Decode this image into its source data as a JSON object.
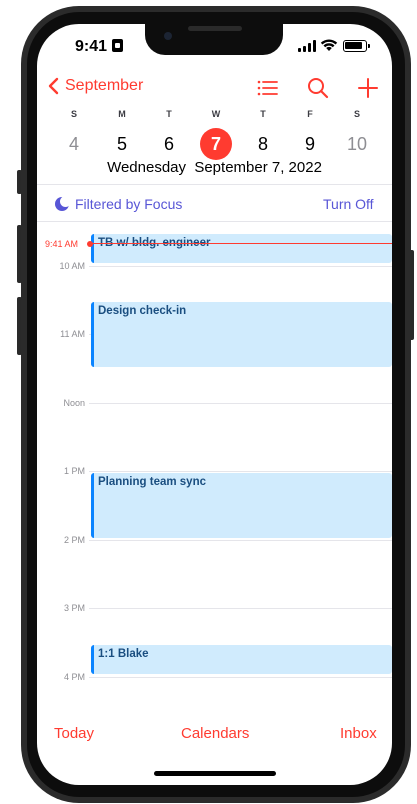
{
  "status_bar": {
    "time": "9:41"
  },
  "header": {
    "back_label": "September"
  },
  "week": {
    "weekdays": [
      "S",
      "M",
      "T",
      "W",
      "T",
      "F",
      "S"
    ],
    "days": [
      "4",
      "5",
      "6",
      "7",
      "8",
      "9",
      "10"
    ],
    "selected_date": "Wednesday  September 7, 2022"
  },
  "focus": {
    "label": "Filtered by Focus",
    "action": "Turn Off"
  },
  "hours": [
    "10 AM",
    "11 AM",
    "Noon",
    "1 PM",
    "2 PM",
    "3 PM",
    "4 PM"
  ],
  "current_time": "9:41 AM",
  "events": [
    {
      "title": "TB w/ bldg. engineer"
    },
    {
      "title": "Design check-in"
    },
    {
      "title": "Planning team sync"
    },
    {
      "title": "1:1 Blake"
    }
  ],
  "bottom_bar": {
    "today": "Today",
    "calendars": "Calendars",
    "inbox": "Inbox"
  },
  "colors": {
    "accent": "#ff3b30",
    "focus": "#5856d6",
    "event_bg": "#d0ebfd",
    "event_bar": "#0a84ff"
  }
}
